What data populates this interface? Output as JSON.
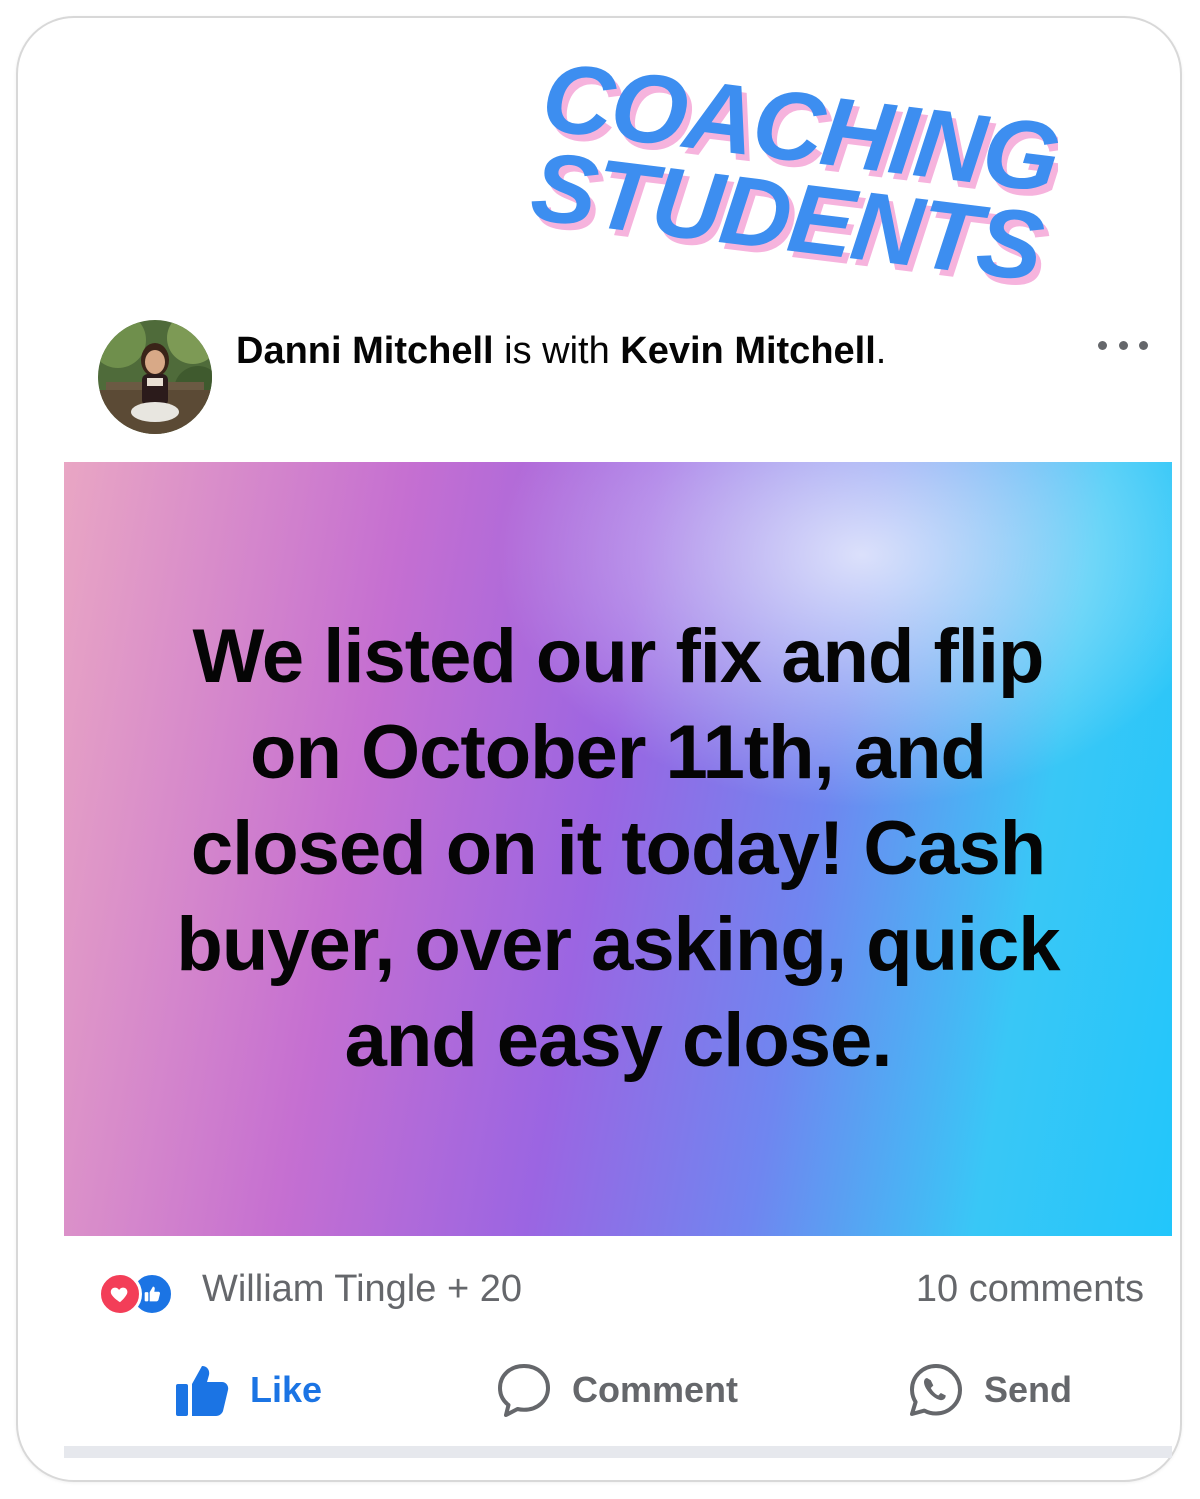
{
  "banner": {
    "line1": "COACHING",
    "line2": "STUDENTS"
  },
  "post": {
    "author": "Danni Mitchell",
    "connector": "is with",
    "tagged": "Kevin Mitchell",
    "tagged_suffix": ".",
    "text": "We listed our fix and flip on October 11th, and closed on it today! Cash buyer, over asking, quick and easy close.",
    "more_icon": "ellipsis-icon"
  },
  "reactions": {
    "icons": [
      "love-icon",
      "like-icon"
    ],
    "summary": "William Tingle + 20",
    "comments": "10 comments"
  },
  "actions": {
    "like_label": "Like",
    "comment_label": "Comment",
    "send_label": "Send"
  },
  "colors": {
    "brand_blue": "#1b74e4",
    "love_red": "#f33e58",
    "banner_blue": "#3d8ef0",
    "banner_shadow": "#f6b3dd"
  }
}
